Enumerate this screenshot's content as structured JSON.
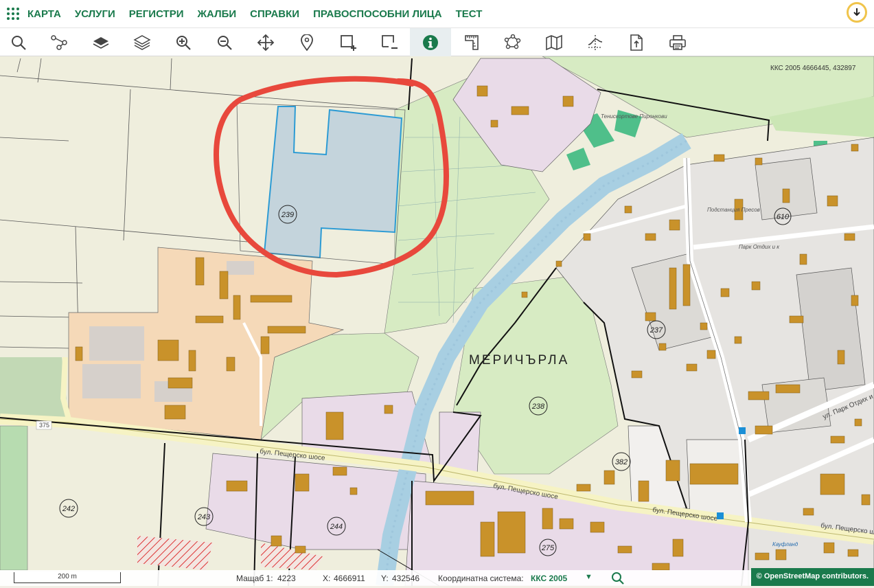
{
  "topnav": {
    "items": [
      "КАРТА",
      "УСЛУГИ",
      "РЕГИСТРИ",
      "ЖАЛБИ",
      "СПРАВКИ",
      "ПРАВОСПОСОБНИ ЛИЦА",
      "ТЕСТ"
    ]
  },
  "toolbar": {
    "tools": [
      "search-icon",
      "route-icon",
      "layer-filled-icon",
      "layers-icon",
      "zoom-in-icon",
      "zoom-out-icon",
      "pan-icon",
      "pin-icon",
      "select-add-icon",
      "select-remove-icon",
      "info-icon",
      "measure-icon",
      "polygon-icon",
      "map-icon",
      "profile-icon",
      "export-icon",
      "print-icon"
    ],
    "active": "info-icon"
  },
  "map": {
    "coord_readout": "ККС 2005 4666445, 432897",
    "district_label": "МЕРИЧЪРЛА",
    "parcels": [
      "239",
      "238",
      "237",
      "382",
      "242",
      "243",
      "244",
      "275",
      "610"
    ],
    "road_labels": [
      "бул. Пещерско шосе",
      "бул. Пещерско шосе",
      "бул. Пещерско шосе",
      "бул. Пещерско шосе",
      "ул. Парк Отдих и к",
      "375"
    ],
    "place_labels": [
      "Тенискортове Пиронкови",
      "Подстанция Пресов",
      "Парк Отдих и к",
      "Кауфланд"
    ]
  },
  "status": {
    "scale_text": "200 m",
    "scale_label": "Мащаб 1:",
    "scale_value": "4223",
    "x_label": "X:",
    "x_value": "4666911",
    "y_label": "Y:",
    "y_value": "432546",
    "crs_label": "Координатна система:",
    "crs_value": "ККС 2005",
    "crs_dropdown": "▼"
  },
  "attribution": "© OpenStreetMap contributors.",
  "colors": {
    "accent": "#1a7a4c",
    "highlight_circle": "#e8483c",
    "selected_parcel": "#c4d4dc",
    "industrial": "#f5d9b8",
    "residential": "#e9dbe8",
    "green": "#d3ebc2",
    "building": "#c9922a"
  }
}
